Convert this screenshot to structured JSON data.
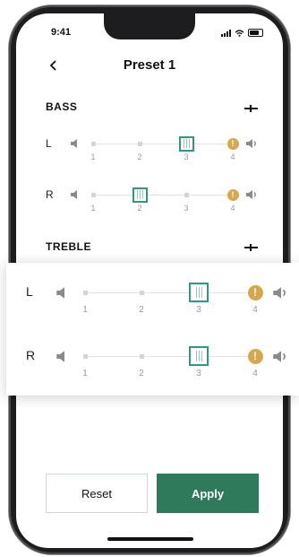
{
  "status_bar": {
    "time": "9:41"
  },
  "header": {
    "title": "Preset 1"
  },
  "bass": {
    "title": "BASS",
    "channels": [
      {
        "label": "L",
        "level": 3
      },
      {
        "label": "R",
        "level": 2
      }
    ]
  },
  "treble": {
    "title": "TREBLE",
    "channels": [
      {
        "label": "L",
        "level": 3
      },
      {
        "label": "R",
        "level": 3
      }
    ]
  },
  "scale_ticks": [
    "1",
    "2",
    "3",
    "4"
  ],
  "warning_glyph": "!",
  "actions": {
    "reset_label": "Reset",
    "apply_label": "Apply"
  },
  "colors": {
    "accent": "#2e7a5a",
    "thumb_border": "#2e9a78",
    "warning": "#d6a74f"
  },
  "icons": [
    "chevron-left-icon",
    "collapse-icon",
    "speaker-low-icon",
    "speaker-high-icon",
    "warning-icon"
  ]
}
